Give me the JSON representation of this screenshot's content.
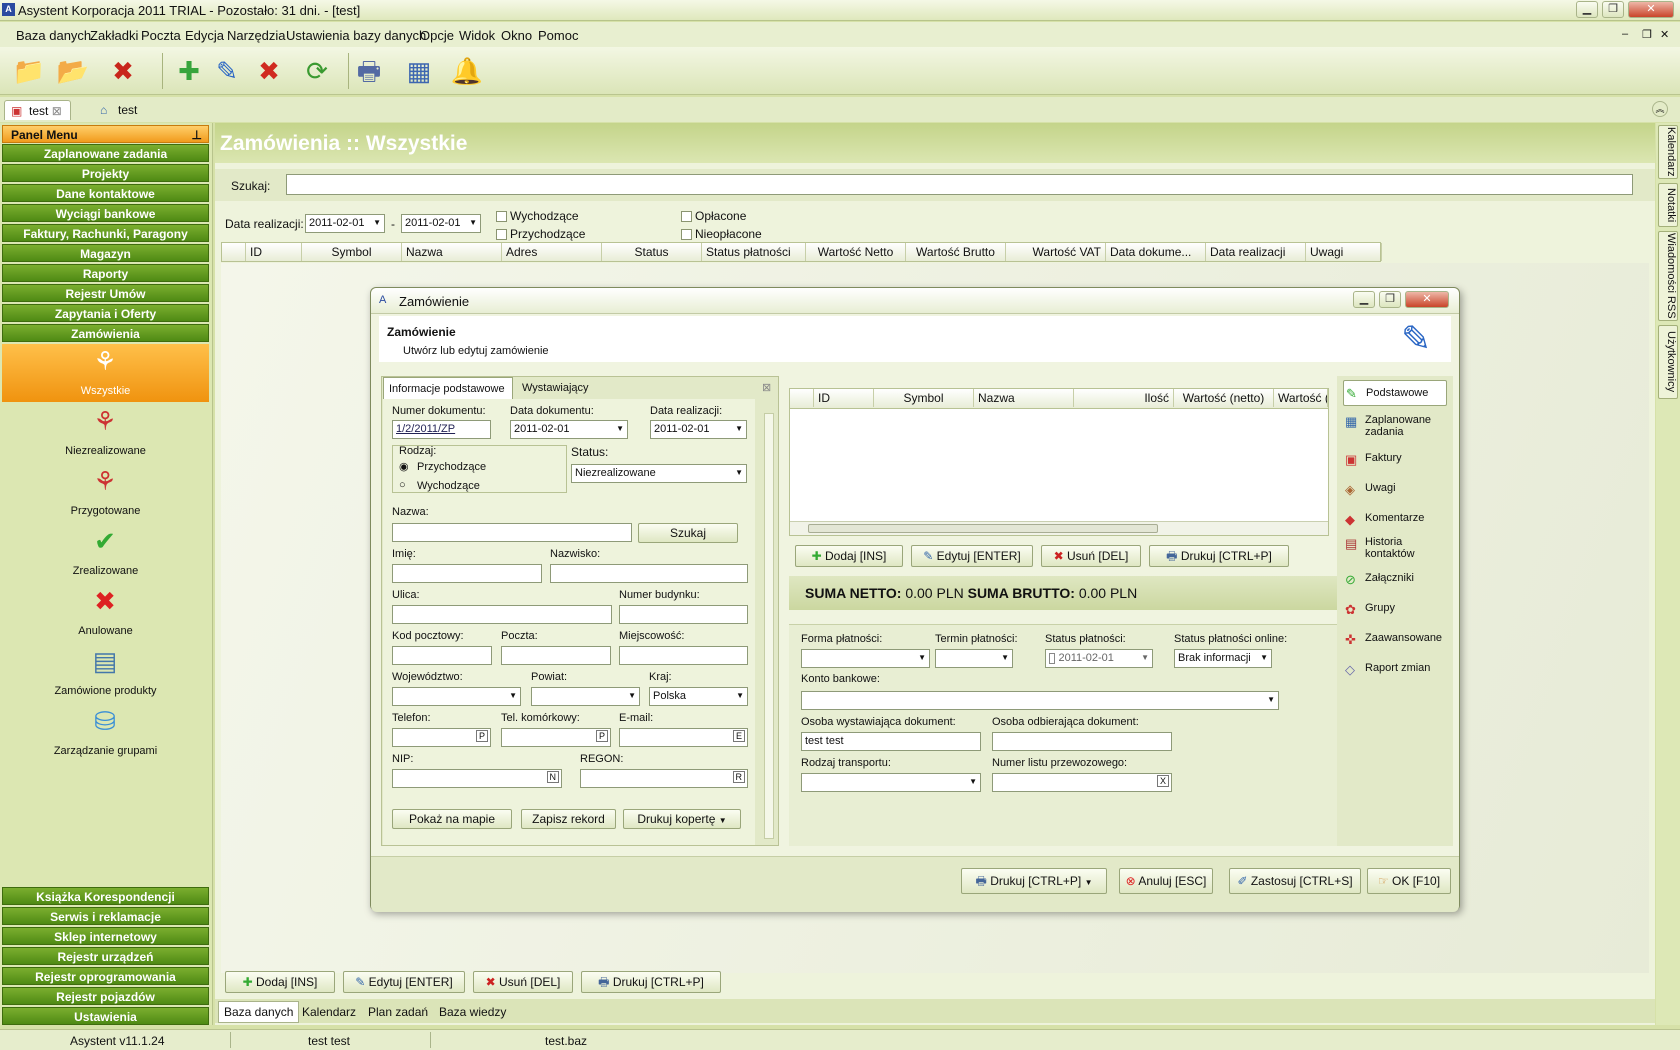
{
  "window": {
    "title": "Asystent Korporacja 2011 TRIAL - Pozostało: 31 dni. - [test]"
  },
  "menu": [
    "Baza danych",
    "Zakładki",
    "Poczta",
    "Edycja",
    "Narzędzia",
    "Ustawienia bazy danych",
    "Opcje",
    "Widok",
    "Okno",
    "Pomoc"
  ],
  "tabs": [
    "test",
    "test"
  ],
  "panel": {
    "title": "Panel Menu",
    "groups_top": [
      "Zaplanowane zadania",
      "Projekty",
      "Dane kontaktowe",
      "Wyciągi bankowe",
      "Faktury, Rachunki, Paragony",
      "Magazyn",
      "Raporty",
      "Rejestr Umów",
      "Zapytania i Oferty",
      "Zamówienia"
    ],
    "subitems": [
      "Wszystkie",
      "Niezrealizowane",
      "Przygotowane",
      "Zrealizowane",
      "Anulowane",
      "Zamówione produkty",
      "Zarządzanie grupami"
    ],
    "groups_bottom": [
      "Książka Korespondencji",
      "Serwis i reklamacje",
      "Sklep internetowy",
      "Rejestr urządzeń",
      "Rejestr oprogramowania",
      "Rejestr pojazdów",
      "Ustawienia"
    ]
  },
  "main": {
    "title": "Zamówienia :: Wszystkie",
    "search_label": "Szukaj:",
    "date_label": "Data realizacji:",
    "date_from": "2011-02-01",
    "date_to": "2011-02-01",
    "dash": "-",
    "filters": [
      "Wychodzące",
      "Przychodzące",
      "Opłacone",
      "Nieopłacone"
    ],
    "columns": [
      "ID",
      "Symbol",
      "Nazwa",
      "Adres",
      "Status",
      "Status płatności",
      "Wartość Netto",
      "Wartość Brutto",
      "Wartość VAT",
      "Data dokume...",
      "Data realizacji",
      "Uwagi"
    ],
    "bottom_buttons": [
      "Dodaj [INS]",
      "Edytuj [ENTER]",
      "Usuń [DEL]",
      "Drukuj [CTRL+P]"
    ],
    "bottom_tabs": [
      "Baza danych",
      "Kalendarz",
      "Plan zadań",
      "Baza wiedzy"
    ]
  },
  "side_tabs": [
    "Kalendarz",
    "Notatki",
    "Wiadomości RSS",
    "Użytkownicy"
  ],
  "dialog": {
    "title": "Zamówienie",
    "header_title": "Zamówienie",
    "header_sub": "Utwórz lub edytuj zamówienie",
    "tabs": [
      "Informacje podstawowe",
      "Wystawiający"
    ],
    "f": {
      "numer_label": "Numer dokumentu:",
      "numer": "1/2/2011/ZP",
      "data_dok_label": "Data dokumentu:",
      "data_dok": "2011-02-01",
      "data_real_label": "Data realizacji:",
      "data_real": "2011-02-01",
      "rodzaj_label": "Rodzaj:",
      "rodzaj1": "Przychodzące",
      "rodzaj2": "Wychodzące",
      "status_label": "Status:",
      "status": "Niezrealizowane",
      "nazwa_label": "Nazwa:",
      "szukaj": "Szukaj",
      "imie_label": "Imię:",
      "nazwisko_label": "Nazwisko:",
      "ulica_label": "Ulica:",
      "nr_bud_label": "Numer budynku:",
      "kod_label": "Kod pocztowy:",
      "poczta_label": "Poczta:",
      "miejsc_label": "Miejscowość:",
      "woj_label": "Województwo:",
      "powiat_label": "Powiat:",
      "kraj_label": "Kraj:",
      "kraj": "Polska",
      "tel_label": "Telefon:",
      "telkom_label": "Tel. komórkowy:",
      "email_label": "E-mail:",
      "nip_label": "NIP:",
      "regon_label": "REGON:",
      "btn_p": "P",
      "btn_e": "E",
      "btn_n": "N",
      "btn_r": "R",
      "mapa": "Pokaż na mapie",
      "zapisz": "Zapisz rekord",
      "koperta": "Drukuj kopertę"
    },
    "grid_cols": [
      "ID",
      "Symbol",
      "Nazwa",
      "Ilość",
      "Wartość (netto)",
      "Wartość (bru"
    ],
    "grid_buttons": [
      "Dodaj [INS]",
      "Edytuj [ENTER]",
      "Usuń [DEL]",
      "Drukuj [CTRL+P]"
    ],
    "sum_netto_label": "SUMA NETTO:",
    "sum_netto": "0.00 PLN",
    "sum_brutto_label": "SUMA BRUTTO:",
    "sum_brutto": "0.00 PLN",
    "p": {
      "forma_label": "Forma płatności:",
      "termin_label": "Termin płatności:",
      "status_pl_label": "Status płatności:",
      "status_pl": "2011-02-01",
      "status_online_label": "Status płatności online:",
      "status_online": "Brak informacji",
      "konto_label": "Konto bankowe:",
      "osoba_wyst_label": "Osoba wystawiająca dokument:",
      "osoba_wyst": "test test",
      "osoba_odb_label": "Osoba odbierająca dokument:",
      "transport_label": "Rodzaj transportu:",
      "list_label": "Numer listu przewozowego:",
      "x": "X"
    },
    "nav": [
      "Podstawowe",
      "Zaplanowane zadania",
      "Faktury",
      "Uwagi",
      "Komentarze",
      "Historia kontaktów",
      "Załączniki",
      "Grupy",
      "Zaawansowane",
      "Raport zmian"
    ],
    "footer": [
      "Drukuj [CTRL+P]",
      "Anuluj [ESC]",
      "Zastosuj [CTRL+S]",
      "OK [F10]"
    ]
  },
  "status": [
    "Asystent v11.1.24",
    "test test",
    "test.baz"
  ]
}
